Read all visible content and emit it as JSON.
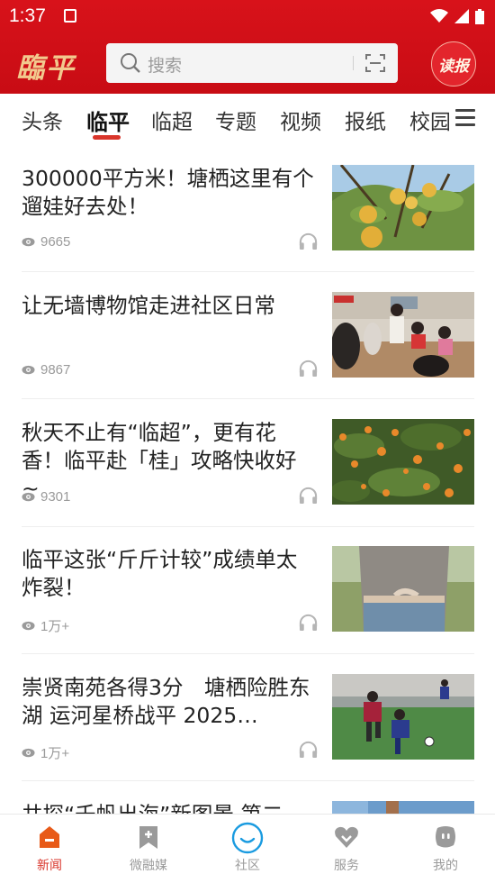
{
  "status": {
    "time": "1:37"
  },
  "header": {
    "logo": "臨平",
    "search_placeholder": "搜索",
    "read_button": "读报"
  },
  "tabs": [
    "头条",
    "临平",
    "临超",
    "专题",
    "视频",
    "报纸",
    "校园"
  ],
  "active_tab": "临平",
  "articles": [
    {
      "title": "300000平方米！塘栖这里有个遛娃好去处！",
      "views": "9665"
    },
    {
      "title": "让无墙博物馆走进社区日常",
      "views": "9867"
    },
    {
      "title": "秋天不止有“临超”，更有花香！临平赴「桂」攻略快收好~",
      "views": "9301"
    },
    {
      "title": "临平这张“斤斤计较”成绩单太炸裂！",
      "views": "1万+"
    },
    {
      "title": "崇贤南苑各得3分　塘栖险胜东湖 运河星桥战平 2025…",
      "views": "1万+"
    },
    {
      "title": "共探“千帆出海”新图景 第二",
      "views": ""
    }
  ],
  "bottom_nav": [
    {
      "label": "新闻",
      "icon": "news-icon"
    },
    {
      "label": "微融媒",
      "icon": "bookmark-icon"
    },
    {
      "label": "社区",
      "icon": "community-icon"
    },
    {
      "label": "服务",
      "icon": "heart-icon"
    },
    {
      "label": "我的",
      "icon": "profile-icon"
    }
  ],
  "colors": {
    "brand_red": "#d8121a",
    "accent": "#d9352b",
    "community_blue": "#1a9be0"
  }
}
